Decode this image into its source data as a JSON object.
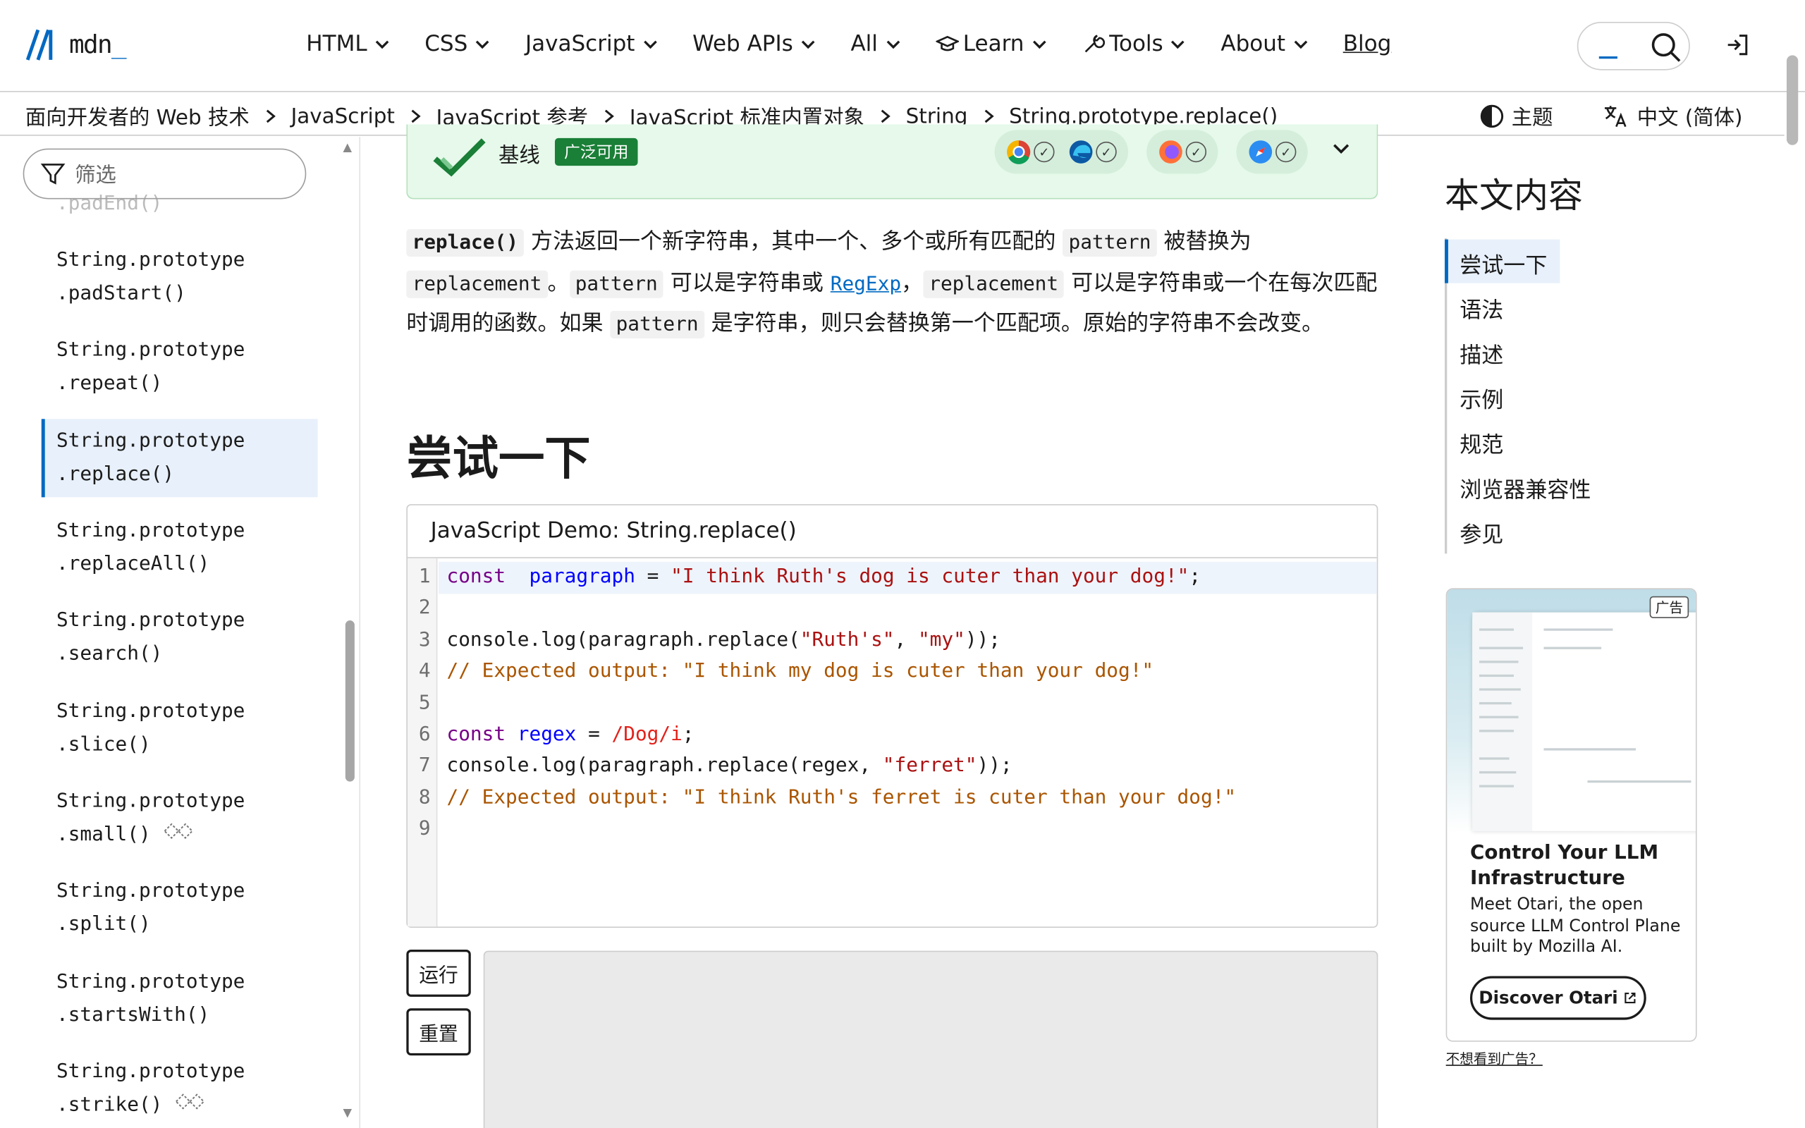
{
  "nav": {
    "logo_text": "mdn",
    "menu": [
      {
        "label": "HTML"
      },
      {
        "label": "CSS"
      },
      {
        "label": "JavaScript"
      },
      {
        "label": "Web APIs"
      },
      {
        "label": "All"
      },
      {
        "label": "Learn"
      },
      {
        "label": "Tools"
      },
      {
        "label": "About"
      }
    ],
    "blog": "Blog"
  },
  "breadcrumb": [
    "面向开发者的 Web 技术",
    "JavaScript",
    "JavaScript 参考",
    "JavaScript 标准内置对象",
    "String",
    "String.prototype.replace()"
  ],
  "theme_label": "主题",
  "lang_label": "中文 (简体)",
  "sidebar": {
    "filter_placeholder": "筛选",
    "faded_item": ".padEnd()",
    "items": [
      {
        "l1": "String.prototype",
        "l2": ".padStart()"
      },
      {
        "l1": "String.prototype",
        "l2": ".repeat()"
      },
      {
        "l1": "String.prototype",
        "l2": ".replace()"
      },
      {
        "l1": "String.prototype",
        "l2": ".replaceAll()"
      },
      {
        "l1": "String.prototype",
        "l2": ".search()"
      },
      {
        "l1": "String.prototype",
        "l2": ".slice()"
      },
      {
        "l1": "String.prototype",
        "l2": ".small()"
      },
      {
        "l1": "String.prototype",
        "l2": ".split()"
      },
      {
        "l1": "String.prototype",
        "l2": ".startsWith()"
      },
      {
        "l1": "String.prototype",
        "l2": ".strike()"
      }
    ]
  },
  "baseline": {
    "label": "基线",
    "badge": "广泛可用"
  },
  "intro": {
    "t0": "replace()",
    "t1": " 方法返回一个新字符串，其中一个、多个或所有匹配的 ",
    "t2": "pattern",
    "t3": " 被替换为 ",
    "t4": "replacement",
    "t5": "。",
    "t6": "pattern",
    "t7": " 可以是字符串或 ",
    "t8": "RegExp",
    "t9": "，",
    "t10": "replacement",
    "t11": " 可以是字符串或一个在每次匹配时调用的函数。如果 ",
    "t12": "pattern",
    "t13": " 是字符串，则只会替换第一个匹配项。原始的字符串不会改变。"
  },
  "section_title": "尝试一下",
  "demo": {
    "title": "JavaScript Demo: String.replace()",
    "lines": [
      {
        "n": "1",
        "parts": [
          [
            "kw",
            "const"
          ],
          [
            "",
            "  "
          ],
          [
            "def",
            "paragraph"
          ],
          [
            "",
            " = "
          ],
          [
            "str",
            "\"I think Ruth's dog is cuter than your dog!\""
          ],
          [
            "",
            ";"
          ]
        ]
      },
      {
        "n": "2",
        "parts": []
      },
      {
        "n": "3",
        "parts": [
          [
            "",
            "console.log(paragraph.replace("
          ],
          [
            "str",
            "\"Ruth's\""
          ],
          [
            "",
            ", "
          ],
          [
            "str",
            "\"my\""
          ],
          [
            "",
            "));"
          ]
        ]
      },
      {
        "n": "4",
        "parts": [
          [
            "cmt",
            "// Expected output: \"I think my dog is cuter than your dog!\""
          ]
        ]
      },
      {
        "n": "5",
        "parts": []
      },
      {
        "n": "6",
        "parts": [
          [
            "kw",
            "const"
          ],
          [
            "",
            " "
          ],
          [
            "def",
            "regex"
          ],
          [
            "",
            " = "
          ],
          [
            "re",
            "/Dog/i"
          ],
          [
            "",
            ";"
          ]
        ]
      },
      {
        "n": "7",
        "parts": [
          [
            "",
            "console.log(paragraph.replace(regex, "
          ],
          [
            "str",
            "\"ferret\""
          ],
          [
            "",
            "));"
          ]
        ]
      },
      {
        "n": "8",
        "parts": [
          [
            "cmt",
            "// Expected output: \"I think Ruth's ferret is cuter than your dog!\""
          ]
        ]
      },
      {
        "n": "9",
        "parts": []
      }
    ]
  },
  "buttons": {
    "run": "运行",
    "reset": "重置"
  },
  "toc": {
    "title": "本文内容",
    "items": [
      "尝试一下",
      "语法",
      "描述",
      "示例",
      "规范",
      "浏览器兼容性",
      "参见"
    ]
  },
  "ad": {
    "tag": "广告",
    "headline": "Control Your LLM Infrastructure",
    "body": "Meet Otari, the open source LLM Control Plane built by Mozilla AI.",
    "cta": "Discover Otari",
    "footer": "不想看到广告？"
  },
  "colors": {
    "accent": "#0069c2",
    "baseline_green": "#1a7f37"
  }
}
